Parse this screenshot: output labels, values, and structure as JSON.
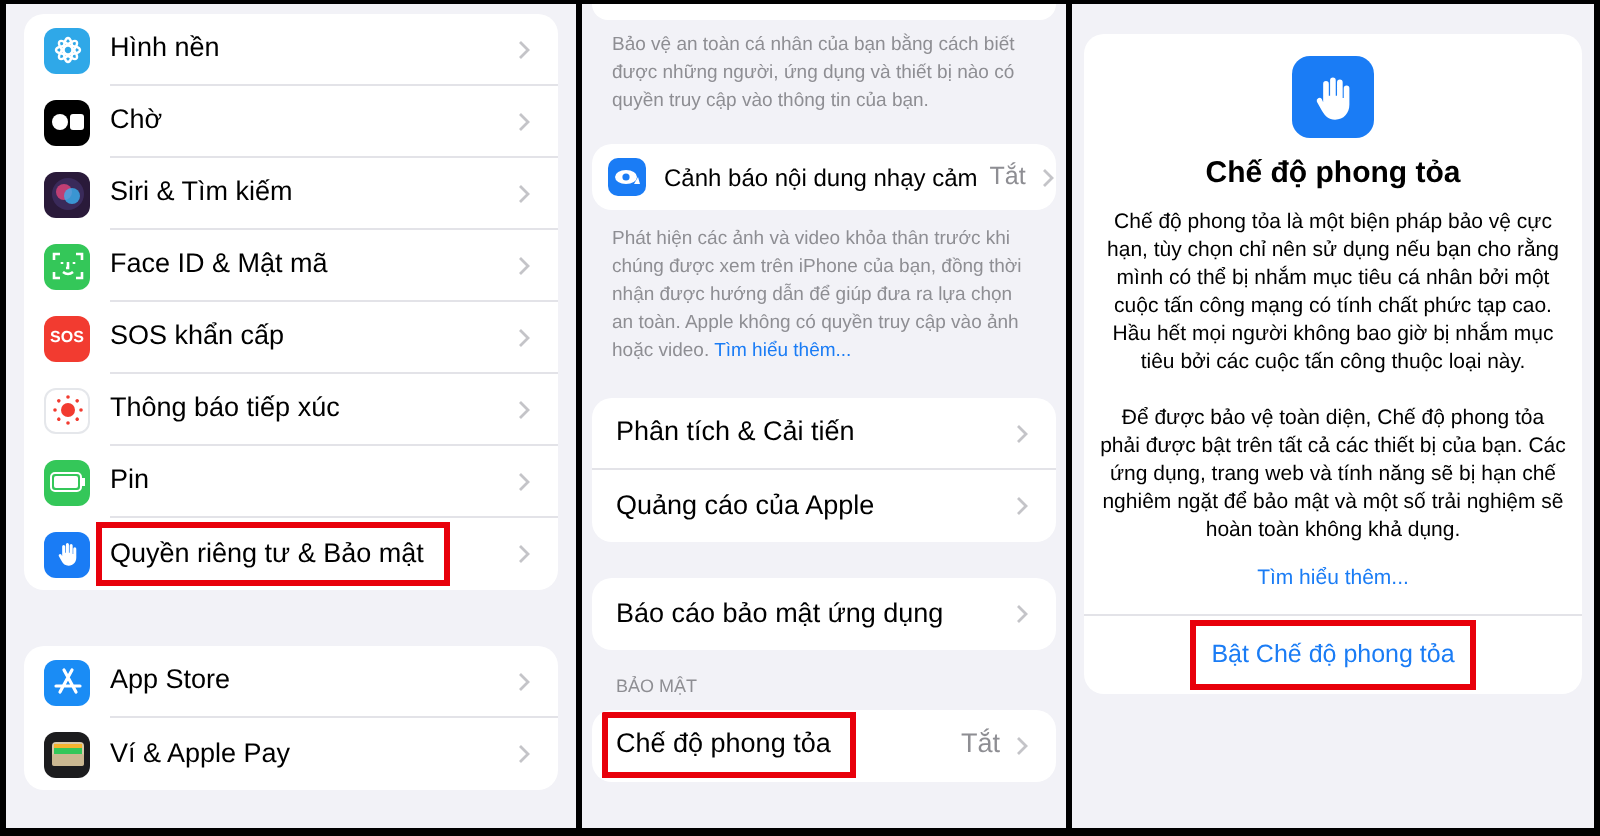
{
  "settings": {
    "groups": [
      {
        "items": [
          {
            "label": "Hình nền",
            "kind": "wallpaper",
            "highlighted": false
          },
          {
            "label": "Chờ",
            "kind": "standby",
            "highlighted": false
          },
          {
            "label": "Siri & Tìm kiếm",
            "kind": "siri",
            "highlighted": false
          },
          {
            "label": "Face ID & Mật mã",
            "kind": "faceid",
            "highlighted": false
          },
          {
            "label": "SOS khẩn cấp",
            "kind": "sos",
            "icon_text": "SOS",
            "highlighted": false
          },
          {
            "label": "Thông báo tiếp xúc",
            "kind": "exposure",
            "highlighted": false
          },
          {
            "label": "Pin",
            "kind": "battery",
            "highlighted": false
          },
          {
            "label": "Quyền riêng tư & Bảo mật",
            "kind": "privacy",
            "highlighted": true
          }
        ]
      },
      {
        "items": [
          {
            "label": "App Store",
            "kind": "appstore",
            "highlighted": false
          },
          {
            "label": "Ví & Apple Pay",
            "kind": "wallet",
            "highlighted": false
          }
        ]
      }
    ]
  },
  "privacy": {
    "intro_footer": "Bảo vệ an toàn cá nhân của bạn bằng cách biết được những người, ứng dụng và thiết bị nào có quyền truy cập vào thông tin của bạn.",
    "sensitive": {
      "label": "Cảnh báo nội dung nhạy cảm",
      "value": "Tắt",
      "footer": "Phát hiện các ảnh và video khỏa thân trước khi chúng được xem trên iPhone của bạn, đồng thời nhận được hướng dẫn để giúp đưa ra lựa chọn an toàn. Apple không có quyền truy cập vào ảnh hoặc video.",
      "footer_link": "Tìm hiểu thêm..."
    },
    "groups": [
      {
        "items": [
          {
            "label": "Phân tích & Cải tiến",
            "highlighted": false
          },
          {
            "label": "Quảng cáo của Apple",
            "highlighted": false
          }
        ]
      },
      {
        "items": [
          {
            "label": "Báo cáo bảo mật ứng dụng",
            "highlighted": false
          }
        ]
      },
      {
        "header": "BẢO MẬT",
        "items": [
          {
            "label": "Chế độ phong tỏa",
            "value": "Tắt",
            "highlighted": true
          }
        ]
      }
    ]
  },
  "lockdown": {
    "title": "Chế độ phong tỏa",
    "paragraphs": [
      "Chế độ phong tỏa là một biện pháp bảo vệ cực hạn, tùy chọn chỉ nên sử dụng nếu bạn cho rằng mình có thể bị nhắm mục tiêu cá nhân bởi một cuộc tấn công mạng có tính chất phức tạp cao. Hầu hết mọi người không bao giờ bị nhắm mục tiêu bởi các cuộc tấn công thuộc loại này.",
      "Để được bảo vệ toàn diện, Chế độ phong tỏa phải được bật trên tất cả các thiết bị của bạn. Các ứng dụng, trang web và tính năng sẽ bị hạn chế nghiêm ngặt để bảo mật và một số trải nghiệm sẽ hoàn toàn không khả dụng."
    ],
    "link": "Tìm hiểu thêm...",
    "button": {
      "label": "Bật Chế độ phong tỏa",
      "highlighted": true
    }
  }
}
